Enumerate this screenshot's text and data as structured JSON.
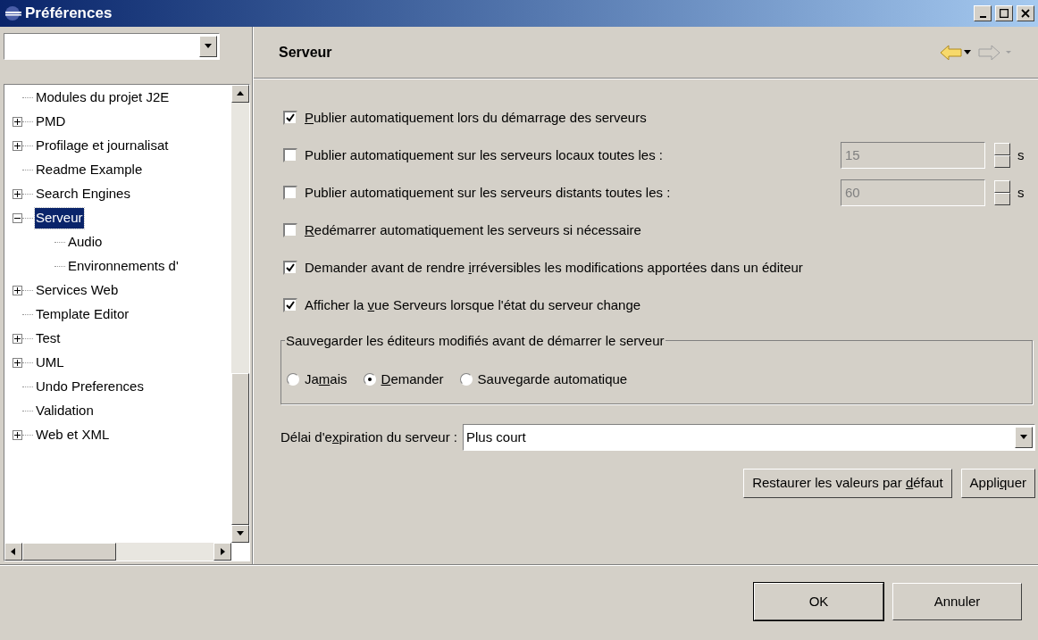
{
  "window": {
    "title": "Préférences"
  },
  "tree": [
    {
      "label": "Modules du projet J2E"
    },
    {
      "label": "PMD",
      "expanded": false
    },
    {
      "label": "Profilage et journalisat",
      "expanded": false
    },
    {
      "label": "Readme Example"
    },
    {
      "label": "Search Engines",
      "expanded": false
    },
    {
      "label": "Serveur",
      "expanded": true,
      "selected": true,
      "children": [
        {
          "label": "Audio"
        },
        {
          "label": "Environnements d'"
        }
      ]
    },
    {
      "label": "Services Web",
      "expanded": false
    },
    {
      "label": "Template Editor"
    },
    {
      "label": "Test",
      "expanded": false
    },
    {
      "label": "UML",
      "expanded": false
    },
    {
      "label": "Undo Preferences"
    },
    {
      "label": "Validation"
    },
    {
      "label": "Web et XML",
      "expanded": false
    }
  ],
  "page": {
    "title": "Serveur"
  },
  "options": [
    {
      "kind": "check",
      "label": {
        "key": "P",
        "post": "ublier automatiquement lors du démarrage des serveurs"
      },
      "checked": true
    },
    {
      "kind": "interval",
      "label": {
        "pre": "Publier automatiquement sur les serveurs locaux toutes les :"
      },
      "checked": false,
      "value": "15",
      "disabled": true,
      "unit": "s"
    },
    {
      "kind": "interval",
      "label": {
        "pre": "Publier automatiquement sur les serveurs distants toutes les :"
      },
      "checked": false,
      "value": "60",
      "disabled": true,
      "unit": "s"
    },
    {
      "kind": "check",
      "label": {
        "key": "R",
        "post": "edémarrer automatiquement les serveurs si nécessaire"
      },
      "checked": false
    },
    {
      "kind": "check",
      "label": {
        "pre": "Demander avant de rendre ",
        "key": "i",
        "post": "rréversibles les modifications apportées dans un éditeur"
      },
      "checked": true
    },
    {
      "kind": "check",
      "label": {
        "pre": "Afficher la ",
        "key": "v",
        "post": "ue Serveurs lorsque l'état du serveur change"
      },
      "checked": true
    }
  ],
  "save_group": {
    "title": "Sauvegarder les éditeurs modifiés avant de démarrer le serveur",
    "choices": [
      {
        "label": {
          "pre": "Ja",
          "key": "m",
          "post": "ais"
        },
        "selected": false
      },
      {
        "label": {
          "key": "D",
          "post": "emander"
        },
        "selected": true
      },
      {
        "label": {
          "pre": "Sauve",
          "key": "g",
          "post": "arde automatique"
        },
        "selected": false
      }
    ]
  },
  "timeout": {
    "label": {
      "pre": "Délai d'e",
      "key": "x",
      "post": "piration du serveur :"
    },
    "value": "Plus court"
  },
  "page_buttons": [
    {
      "label": {
        "pre": "Restaurer les valeurs par ",
        "key": "d",
        "post": "éfaut"
      }
    },
    {
      "label": {
        "pre": "Appli",
        "key": "q",
        "post": "uer"
      }
    }
  ],
  "dialog_buttons": [
    {
      "label": "OK",
      "default": true
    },
    {
      "label": "Annuler",
      "default": false
    }
  ]
}
